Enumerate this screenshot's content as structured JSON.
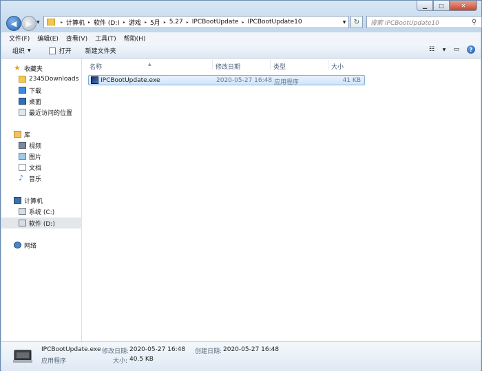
{
  "window": {
    "caption_buttons": {
      "minimize": "▁",
      "maximize": "□",
      "close": "✕"
    }
  },
  "address": {
    "path": [
      "计算机",
      "软件 (D:)",
      "游戏",
      "5月",
      "5.27",
      "IPCBootUpdate",
      "IPCBootUpdate10"
    ],
    "separator": "▸",
    "search_placeholder": "搜索 IPCBootUpdate10"
  },
  "menu": [
    "文件(F)",
    "编辑(E)",
    "查看(V)",
    "工具(T)",
    "帮助(H)"
  ],
  "toolbar": {
    "organize": "组织",
    "open": "打开",
    "new_folder": "新建文件夹"
  },
  "nav": {
    "favorites_header": "收藏夹",
    "favorites": [
      "2345Downloads",
      "下载",
      "桌面",
      "最近访问的位置"
    ],
    "libraries_header": "库",
    "libraries": [
      "视频",
      "图片",
      "文档",
      "音乐"
    ],
    "computer_header": "计算机",
    "drives": [
      "系统 (C:)",
      "软件 (D:)"
    ],
    "network": "网络"
  },
  "columns": {
    "name": "名称",
    "modified": "修改日期",
    "type": "类型",
    "size": "大小"
  },
  "files": [
    {
      "name": "IPCBootUpdate.exe",
      "modified": "2020-05-27 16:48",
      "type": "应用程序",
      "size": "41 KB"
    }
  ],
  "details": {
    "name": "IPCBootUpdate.exe",
    "type": "应用程序",
    "modified_label": "修改日期:",
    "modified": "2020-05-27 16:48",
    "created_label": "创建日期:",
    "created": "2020-05-27 16:48",
    "size_label": "大小:",
    "size": "40.5 KB"
  },
  "colors": {
    "selection": "#cfe4fa",
    "accent": "#1f5ea8"
  }
}
